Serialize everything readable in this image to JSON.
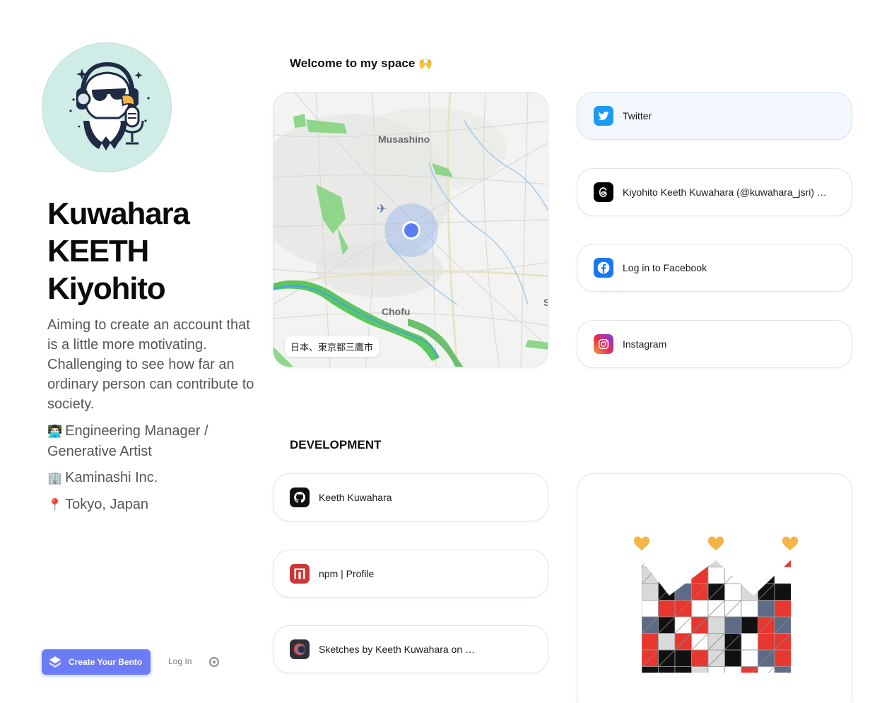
{
  "profile": {
    "name_line1": "Kuwahara",
    "name_line2": "KEETH",
    "name_line3": "Kiyohito",
    "bio": "Aiming to create an account that is a little more motivating. Challenging to see how far an ordinary person can contribute to society.",
    "role_emoji": "👨🏻‍💻",
    "role": "Engineering Manager / Generative Artist",
    "company_emoji": "🏢",
    "company": "Kaminashi Inc.",
    "location_emoji": "📍",
    "location": "Tokyo, Japan"
  },
  "welcome": {
    "title": "Welcome to my space",
    "emoji": "🙌"
  },
  "map": {
    "location_label": "日本、東京都三鷹市",
    "place1": "Musashino",
    "place2": "Chofu",
    "place3": "S"
  },
  "social": [
    {
      "label": "Twitter",
      "icon": "twitter-icon",
      "color": "#1d9bf0"
    },
    {
      "label": "Kiyohito Keeth Kuwahara (@kuwahara_jsri) …",
      "icon": "threads-icon",
      "color": "#000000"
    },
    {
      "label": "Log in to Facebook",
      "icon": "facebook-icon",
      "color": "#1877f2"
    },
    {
      "label": "Instagram",
      "icon": "instagram-icon",
      "color": "#e1306c"
    }
  ],
  "development": {
    "title": "DEVELOPMENT",
    "links": [
      {
        "label": "Keeth Kuwahara",
        "icon": "github-icon"
      },
      {
        "label": "npm | Profile",
        "icon": "npm-icon"
      },
      {
        "label": "Sketches by Keeth Kuwahara on …",
        "icon": "openprocessing-icon"
      }
    ]
  },
  "footer": {
    "create_label": "Create Your Bento",
    "login_label": "Log In"
  },
  "colors": {
    "accent": "#6c7cf6",
    "avatar_bg": "#cfece6",
    "twitter_card_bg": "#f2f7fd"
  }
}
